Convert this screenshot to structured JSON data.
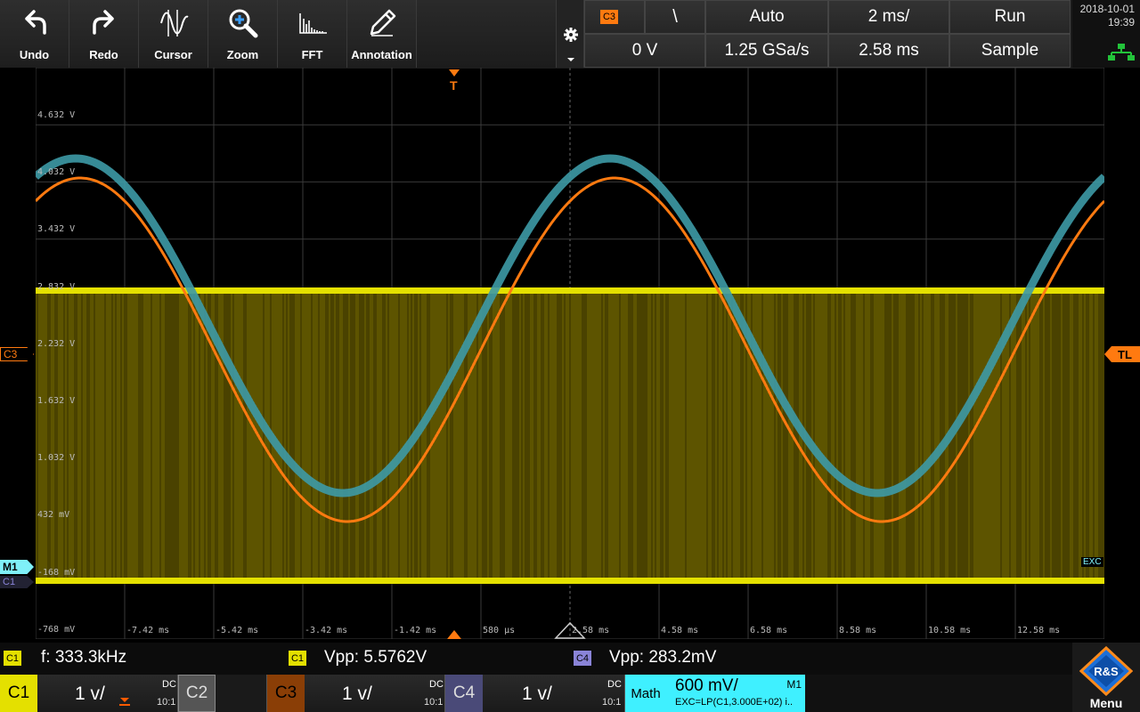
{
  "toolbar": {
    "tools": [
      {
        "label": "Undo",
        "icon": "undo-icon"
      },
      {
        "label": "Redo",
        "icon": "redo-icon"
      },
      {
        "label": "Cursor",
        "icon": "cursor-icon"
      },
      {
        "label": "Zoom",
        "icon": "zoom-icon"
      },
      {
        "label": "FFT",
        "icon": "fft-icon"
      },
      {
        "label": "Annotation",
        "icon": "annotation-icon"
      }
    ],
    "trigger": {
      "source": "C3",
      "slope_symbol": "\\",
      "mode": "Auto",
      "level": "0 V"
    },
    "timebase": {
      "scale": "2 ms/",
      "sample_rate": "1.25 GSa/s",
      "position": "2.58 ms"
    },
    "acquisition": {
      "state": "Run",
      "mode": "Sample"
    },
    "date": "2018-10-01",
    "time": "19:39"
  },
  "screen": {
    "y_labels": [
      "4.632 V",
      "4.032 V",
      "3.432 V",
      "2.832 V",
      "2.232 V",
      "1.632 V",
      "1.032 V",
      "432 mV",
      "-168 mV",
      "-768 mV"
    ],
    "x_labels": [
      "-7.42 ms",
      "-5.42 ms",
      "-3.42 ms",
      "-1.42 ms",
      "580 µs",
      "2.58 ms",
      "4.58 ms",
      "6.58 ms",
      "8.58 ms",
      "10.58 ms",
      "12.58 ms"
    ],
    "trigger_marker": "T",
    "trigger_level_marker": "TL",
    "markers": {
      "c3": "C3",
      "m1": "M1",
      "c1": "C1"
    },
    "exc_label": "EXC",
    "colors": {
      "c1": "#e4e000",
      "c3": "#ff7a10",
      "math": "#3d9aa6",
      "c4": "#8a84d8",
      "grid": "#3a3a3a"
    }
  },
  "measurements": [
    {
      "source": "C1",
      "text": "f: 333.3kHz"
    },
    {
      "source": "C1",
      "text": "Vpp: 5.5762V"
    },
    {
      "source": "C4",
      "text": "Vpp: 283.2mV"
    }
  ],
  "channels": [
    {
      "name": "C1",
      "scale": "1 v/",
      "coupling": "DC",
      "probe": "10:1"
    },
    {
      "name": "C2",
      "scale": "",
      "coupling": "",
      "probe": ""
    },
    {
      "name": "C3",
      "scale": "1 v/",
      "coupling": "DC",
      "probe": "10:1"
    },
    {
      "name": "C4",
      "scale": "1 v/",
      "coupling": "DC",
      "probe": "10:1"
    }
  ],
  "math": {
    "name": "Math",
    "scale": "600 mV/",
    "id": "M1",
    "expression": "EXC=LP(C1,3.000E+02) i.."
  },
  "menu": {
    "label": "Menu",
    "logo_text": "R&S"
  }
}
